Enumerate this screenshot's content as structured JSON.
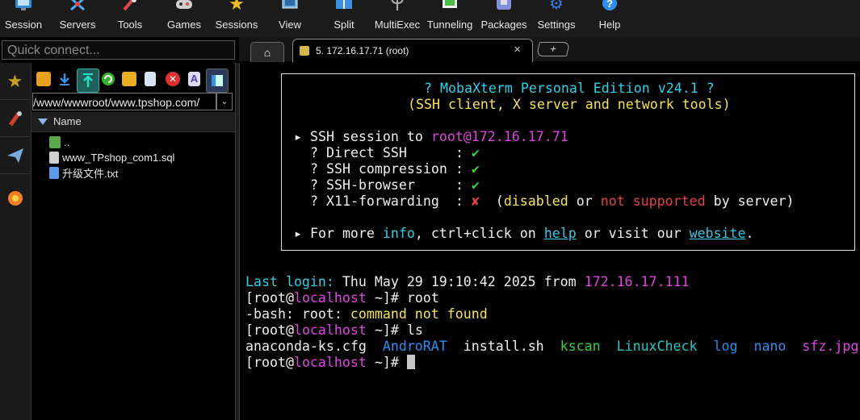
{
  "toolbar": {
    "items": [
      {
        "label": "Session",
        "icon": "session-icon",
        "color": "#3aa3e8"
      },
      {
        "label": "Servers",
        "icon": "servers-icon",
        "color": "#4fa8f0"
      },
      {
        "label": "Tools",
        "icon": "tools-icon",
        "color": "#e04848"
      },
      {
        "label": "Games",
        "icon": "games-icon",
        "color": "#cfcfcf"
      },
      {
        "label": "Sessions",
        "icon": "star-icon",
        "color": "#f0c020"
      },
      {
        "label": "View",
        "icon": "view-icon",
        "color": "#6ab0e0"
      },
      {
        "label": "Split",
        "icon": "split-icon",
        "color": "#3a8fe0"
      },
      {
        "label": "MultiExec",
        "icon": "multiexec-icon",
        "color": "#b0b0b0"
      },
      {
        "label": "Tunneling",
        "icon": "tunneling-icon",
        "color": "#48c048"
      },
      {
        "label": "Packages",
        "icon": "packages-icon",
        "color": "#7f8fd8"
      },
      {
        "label": "Settings",
        "icon": "gear-icon",
        "color": "#3a7ff0"
      },
      {
        "label": "Help",
        "icon": "help-icon",
        "color": "#2e8ef0"
      }
    ]
  },
  "quick_connect": {
    "placeholder": "Quick connect..."
  },
  "tabs": {
    "session_tab": {
      "label": "5. 172.16.17.71 (root)"
    },
    "close": "×",
    "plus": "+"
  },
  "file_panel": {
    "path": "/www/wwwroot/www.tpshop.com/",
    "column_name": "Name",
    "files": [
      {
        "name": "..",
        "icon": "parent-folder-icon",
        "color": "#5aa84a"
      },
      {
        "name": "www_TPshop_com1.sql",
        "icon": "file-icon",
        "color": "#cccccc"
      },
      {
        "name": "升级文件.txt",
        "icon": "text-file-icon",
        "color": "#3a8fe0"
      }
    ]
  },
  "terminal": {
    "banner": {
      "title": "? MobaXterm Personal Edition v24.1 ?",
      "subtitle": "(SSH client, X server and network tools)",
      "ssh_session_prefix": "▸ SSH session to ",
      "ssh_target": "root@172.16.17.71",
      "options": [
        {
          "label": "? Direct SSH      :",
          "value": "✔"
        },
        {
          "label": "? SSH compression :",
          "value": "✔"
        },
        {
          "label": "? SSH-browser     :",
          "value": "✔"
        }
      ],
      "x11_label": "? X11-forwarding  :",
      "x11_value": "✘",
      "x11_open": "  (",
      "x11_disabled": "disabled",
      "x11_or": " or ",
      "x11_not_supported": "not supported",
      "x11_by_server": " by server)",
      "more_prefix": "▸ For more ",
      "more_info": "info",
      "more_mid": ", ctrl+click on ",
      "more_help": "help",
      "more_or": " or visit our ",
      "more_website": "website",
      "more_end": "."
    },
    "last_login_label": "Last login:",
    "last_login_value": " Thu May 29 19:10:42 2025 from ",
    "last_login_ip": "172.16.17.111",
    "prompt_open": "[root@",
    "prompt_host": "localhost",
    "prompt_close": " ~]# ",
    "cmd1": "root",
    "error_prefix": "-bash: root: ",
    "error_msg": "command not found",
    "cmd2": "ls",
    "ls_output": [
      {
        "name": "anaconda-ks.cfg",
        "kind": "file"
      },
      {
        "name": "AndroRAT",
        "kind": "dir"
      },
      {
        "name": "install.sh",
        "kind": "file"
      },
      {
        "name": "kscan",
        "kind": "exec"
      },
      {
        "name": "LinuxCheck",
        "kind": "dir"
      },
      {
        "name": "log",
        "kind": "dir"
      },
      {
        "name": "nano",
        "kind": "dir"
      },
      {
        "name": "sfz.jpg",
        "kind": "image"
      }
    ]
  }
}
